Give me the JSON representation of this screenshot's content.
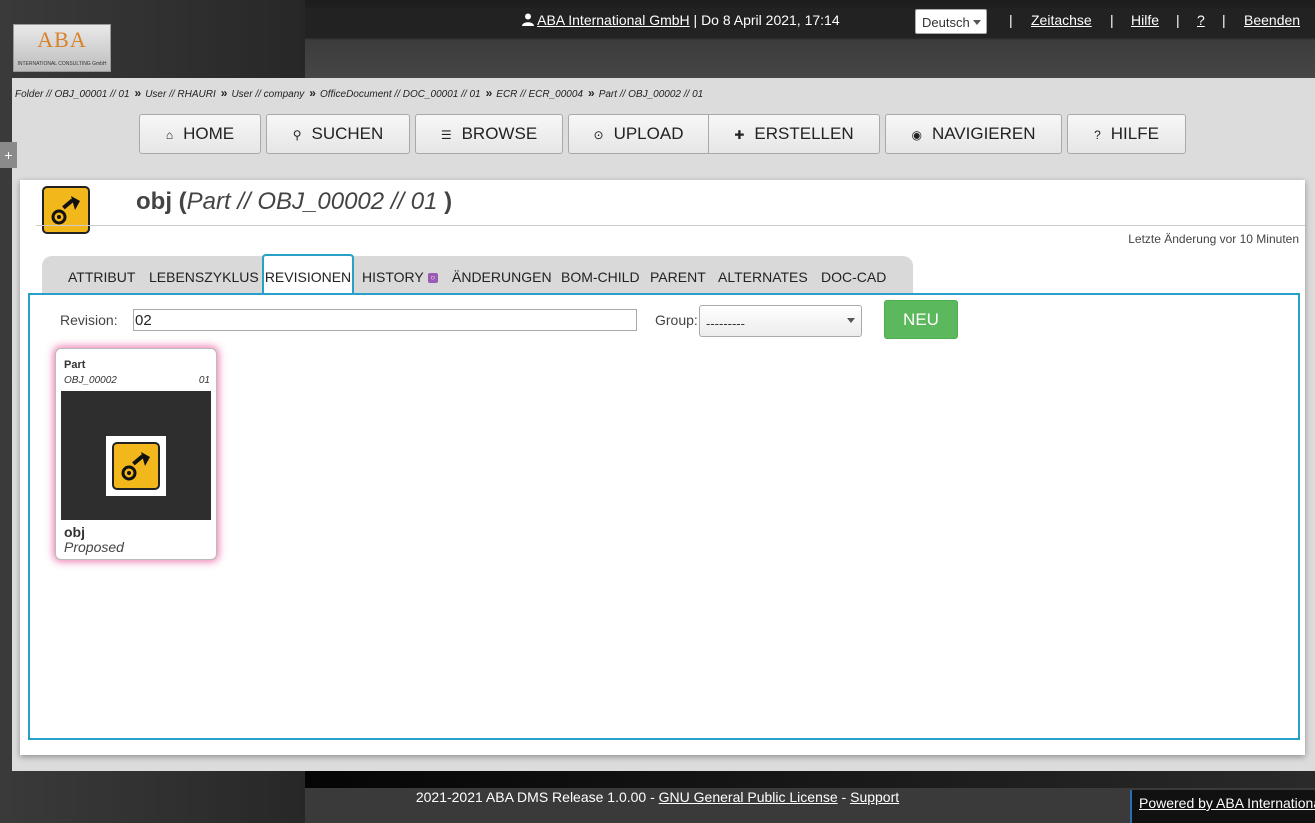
{
  "header": {
    "logo_text": "ABA",
    "logo_subtitle": "INTERNATIONAL CONSULTING GmbH",
    "user_icon": "user-icon",
    "company_link": "ABA International GmbH",
    "datetime": " | Do 8 April 2021, 17:14",
    "language": "Deutsch",
    "links": [
      "Zeitachse",
      "Hilfe",
      "?",
      "Beenden"
    ],
    "separator": "|"
  },
  "breadcrumb": [
    "Folder // OBJ_00001 // 01",
    "User // RHAURI",
    "User // company",
    "OfficeDocument // DOC_00001 // 01",
    "ECR // ECR_00004",
    "Part // OBJ_00002 // 01"
  ],
  "breadcrumb_sep": "»",
  "sidebar_toggle": "+",
  "nav": {
    "home": {
      "label": "HOME",
      "icon": "home-icon",
      "glyph": "⌂"
    },
    "suchen": {
      "label": "SUCHEN",
      "icon": "search-icon",
      "glyph": "⚲"
    },
    "browse": {
      "label": "BROWSE",
      "icon": "list-icon",
      "glyph": "☰"
    },
    "upload": {
      "label": "UPLOAD",
      "icon": "upload-icon",
      "glyph": "⊙"
    },
    "erstellen": {
      "label": "ERSTELLEN",
      "icon": "plus-icon",
      "glyph": "✚"
    },
    "navigieren": {
      "label": "NAVIGIEREN",
      "icon": "eye-icon",
      "glyph": "◉"
    },
    "hilfe": {
      "label": "HILFE",
      "icon": "help-icon",
      "glyph": "?"
    }
  },
  "object": {
    "name": "obj",
    "open_paren": " (",
    "identifier": "Part // OBJ_00002 //  01",
    "close_paren": " )",
    "icon": "part-icon",
    "last_change": "Letzte Änderung vor 10 Minuten"
  },
  "tabs": {
    "attribut": "ATTRIBUT",
    "lebenszyklus": "LEBENSZYKLUS",
    "revisionen": "REVISIONEN",
    "history": "HISTORY",
    "aenderungen": "ÄNDERUNGEN",
    "bom_child": "BOM-CHILD",
    "parent": "PARENT",
    "alternates": "ALTERNATES",
    "doc_cad": "DOC-CAD"
  },
  "revision_form": {
    "revision_label": "Revision:",
    "revision_value": "02",
    "group_label": "Group:",
    "group_value": "---------",
    "new_button": "NEU"
  },
  "revision_card": {
    "type": "Part",
    "number": "OBJ_00002",
    "revision": "01",
    "name": "obj",
    "status": "Proposed",
    "thumbnail_icon": "part-icon"
  },
  "footer": {
    "text": "2021-2021 ABA DMS Release 1.0.00 - ",
    "license_link": "GNU General Public License",
    "dash": " - ",
    "support_link": "Support",
    "powered": "Powered by ABA International"
  },
  "colors": {
    "accent": "#27a1c7",
    "new_button": "#5cb85c",
    "part_icon": "#f2b71a",
    "card_glow": "#e65096"
  }
}
